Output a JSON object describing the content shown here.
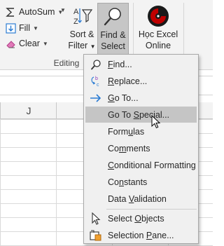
{
  "ribbon": {
    "autosum_label": "AutoSum",
    "fill_label": "Fill",
    "clear_label": "Clear",
    "sort_filter_line1": "Sort &",
    "sort_filter_line2": "Filter",
    "find_select_line1": "Find &",
    "find_select_line2": "Select",
    "hoc_excel_line1": "Học Excel",
    "hoc_excel_line2": "Online",
    "group_label": "Editing"
  },
  "grid": {
    "column_label": "J"
  },
  "menu": {
    "items": [
      {
        "label": "Find...",
        "icon": "search-icon"
      },
      {
        "label": "Replace...",
        "icon": "replace-icon"
      },
      {
        "label": "Go To...",
        "icon": "arrow-right-icon"
      },
      {
        "label": "Go To Special...",
        "icon": ""
      },
      {
        "label": "Formulas",
        "icon": ""
      },
      {
        "label": "Comments",
        "icon": ""
      },
      {
        "label": "Conditional Formatting",
        "icon": ""
      },
      {
        "label": "Constants",
        "icon": ""
      },
      {
        "label": "Data Validation",
        "icon": ""
      },
      {
        "label": "Select Objects",
        "icon": "pointer-icon"
      },
      {
        "label": "Selection Pane...",
        "icon": "selection-pane-icon"
      }
    ],
    "highlighted_index": 3
  },
  "colors": {
    "ribbon_bg": "#f3f3f3",
    "menu_bg": "#f0f0f0",
    "highlight": "#c5c5c5",
    "accent_blue": "#2b7cd3",
    "logo_red": "#c00000"
  }
}
